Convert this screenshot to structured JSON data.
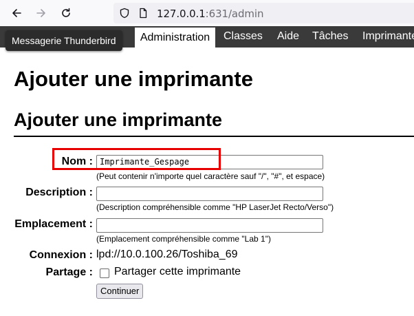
{
  "browser": {
    "url_host": "127.0.0.1",
    "url_rest": ":631/admin",
    "tooltip": "Messagerie Thunderbird"
  },
  "nav": {
    "tabs": [
      {
        "label": "Administration",
        "active": true
      },
      {
        "label": "Classes",
        "active": false
      },
      {
        "label": "Aide",
        "active": false
      },
      {
        "label": "Tâches",
        "active": false
      },
      {
        "label": "Imprimantes",
        "active": false
      }
    ]
  },
  "page": {
    "title": "Ajouter une imprimante",
    "section_title": "Ajouter une imprimante"
  },
  "form": {
    "name_label": "Nom :",
    "name_value": "Imprimante_Gespage",
    "name_hint": "(Peut contenir n'importe quel caractère sauf \"/\", \"#\", et espace)",
    "description_label": "Description :",
    "description_value": "",
    "description_hint": "(Description compréhensible comme \"HP LaserJet Recto/Verso\")",
    "location_label": "Emplacement :",
    "location_value": "",
    "location_hint": "(Emplacement compréhensible comme \"Lab 1\")",
    "connection_label": "Connexion :",
    "connection_value": "lpd://10.0.100.26/Toshiba_69",
    "sharing_label": "Partage :",
    "sharing_checkbox_label": "Partager cette imprimante",
    "sharing_checked": false,
    "continue_label": "Continuer"
  },
  "colors": {
    "highlight": "#e60000",
    "header_bar": "#3a3a3a"
  }
}
